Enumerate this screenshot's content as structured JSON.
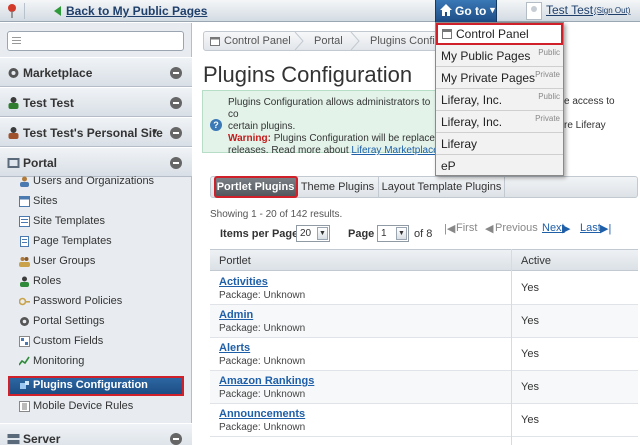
{
  "dockbar": {
    "back_label": "Back to My Public Pages",
    "goto_label": "Go to",
    "user_name": "Test Test",
    "sign_out": "(Sign Out)"
  },
  "goto_menu": [
    {
      "label": "Control Panel",
      "tag": ""
    },
    {
      "label": "My Public Pages",
      "tag": "Public"
    },
    {
      "label": "My Private Pages",
      "tag": "Private"
    },
    {
      "label": "Liferay, Inc.",
      "tag": "Public"
    },
    {
      "label": "Liferay, Inc.",
      "tag": "Private"
    },
    {
      "label": "Liferay",
      "tag": ""
    },
    {
      "label": "eP",
      "tag": ""
    }
  ],
  "sidebar": {
    "panels": {
      "marketplace": "Marketplace",
      "user": "Test Test",
      "personal_site": "Test Test's Personal Site",
      "portal": "Portal",
      "server": "Server"
    },
    "items": [
      {
        "label": "Users and Organizations",
        "icon": "users-icon"
      },
      {
        "label": "Sites",
        "icon": "sites-icon"
      },
      {
        "label": "Site Templates",
        "icon": "site-templates-icon"
      },
      {
        "label": "Page Templates",
        "icon": "page-templates-icon"
      },
      {
        "label": "User Groups",
        "icon": "user-groups-icon"
      },
      {
        "label": "Roles",
        "icon": "roles-icon"
      },
      {
        "label": "Password Policies",
        "icon": "password-icon"
      },
      {
        "label": "Portal Settings",
        "icon": "gear-icon"
      },
      {
        "label": "Custom Fields",
        "icon": "custom-fields-icon"
      },
      {
        "label": "Monitoring",
        "icon": "monitoring-icon"
      },
      {
        "label": "Plugins Configuration",
        "icon": "plugin-icon"
      },
      {
        "label": "Mobile Device Rules",
        "icon": "mobile-icon"
      }
    ]
  },
  "breadcrumb": [
    "Control Panel",
    "Portal",
    "Plugins Configur"
  ],
  "page_title": "Plugins Configuration",
  "info": {
    "line1": "Plugins Configuration allows administrators to co",
    "line2": "certain plugins.",
    "warning_label": "Warning:",
    "line3": " Plugins Configuration will be replaced",
    "line4": "releases. Read more about ",
    "link": "Liferay Marketplace",
    "right1": "e access to",
    "right3": "re Liferay"
  },
  "tabs": [
    "Portlet Plugins",
    "Theme Plugins",
    "Layout Template Plugins"
  ],
  "results_text": "Showing 1 - 20 of 142 results.",
  "pagination": {
    "items_per_page_label": "Items per Page",
    "items_per_page_value": "20",
    "page_label": "Page",
    "page_value": "1",
    "of_label": "of 8",
    "first": "First",
    "previous": "Previous",
    "next": "Next",
    "last": "Last"
  },
  "table": {
    "columns": [
      "Portlet",
      "Active"
    ],
    "rows": [
      {
        "name": "Activities",
        "package": "Package: Unknown",
        "active": "Yes"
      },
      {
        "name": "Admin",
        "package": "Package: Unknown",
        "active": "Yes"
      },
      {
        "name": "Alerts",
        "package": "Package: Unknown",
        "active": "Yes"
      },
      {
        "name": "Amazon Rankings",
        "package": "Package: Unknown",
        "active": "Yes"
      },
      {
        "name": "Announcements",
        "package": "Package: Unknown",
        "active": "Yes"
      }
    ]
  },
  "colors": {
    "accent_blue": "#1f4d85",
    "highlight_red": "#d0202a",
    "info_bg": "#e3f3ea",
    "warning_red": "#c41a1a",
    "link_blue": "#1f5fa8"
  }
}
